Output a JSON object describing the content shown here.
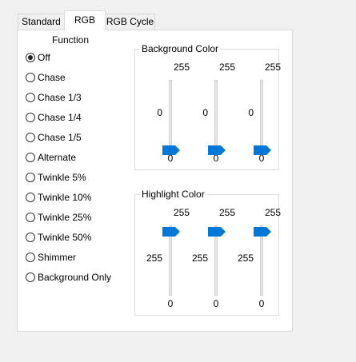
{
  "tabs": [
    "Standard",
    "RGB",
    "RGB Cycle"
  ],
  "function_label": "Function",
  "functions": [
    {
      "label": "Off",
      "checked": true
    },
    {
      "label": "Chase",
      "checked": false
    },
    {
      "label": "Chase 1/3",
      "checked": false
    },
    {
      "label": "Chase 1/4",
      "checked": false
    },
    {
      "label": "Chase 1/5",
      "checked": false
    },
    {
      "label": "Alternate",
      "checked": false
    },
    {
      "label": "Twinkle 5%",
      "checked": false
    },
    {
      "label": "Twinkle 10%",
      "checked": false
    },
    {
      "label": "Twinkle 25%",
      "checked": false
    },
    {
      "label": "Twinkle 50%",
      "checked": false
    },
    {
      "label": "Shimmer",
      "checked": false
    },
    {
      "label": "Background Only",
      "checked": false
    }
  ],
  "background": {
    "title": "Background Color",
    "sliders": [
      {
        "max": "255",
        "min": "0",
        "value": "0",
        "level": 0
      },
      {
        "max": "255",
        "min": "0",
        "value": "0",
        "level": 0
      },
      {
        "max": "255",
        "min": "0",
        "value": "0",
        "level": 0
      }
    ]
  },
  "highlight": {
    "title": "Highlight Color",
    "sliders": [
      {
        "max": "255",
        "min": "0",
        "value": "255",
        "level": 1
      },
      {
        "max": "255",
        "min": "0",
        "value": "255",
        "level": 1
      },
      {
        "max": "255",
        "min": "0",
        "value": "255",
        "level": 1
      }
    ]
  },
  "colors": {
    "thumb": "#0078d7",
    "border": "#d9d9d9"
  }
}
